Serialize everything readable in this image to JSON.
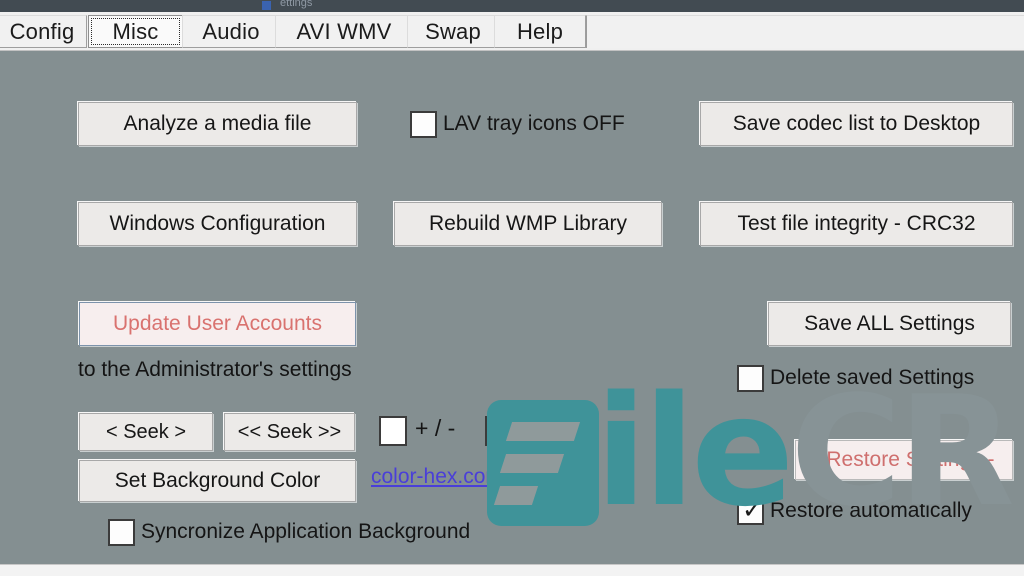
{
  "window": {
    "title_fragment": "ettings",
    "app_icon": "app-icon"
  },
  "tabs": [
    {
      "id": "config",
      "label": "Config",
      "selected": false
    },
    {
      "id": "misc",
      "label": "Misc",
      "selected": true
    },
    {
      "id": "audio",
      "label": "Audio",
      "selected": false
    },
    {
      "id": "aviwmv",
      "label": "AVI WMV",
      "selected": false
    },
    {
      "id": "swap",
      "label": "Swap",
      "selected": false
    },
    {
      "id": "help",
      "label": "Help",
      "selected": false
    }
  ],
  "main": {
    "analyze_button": "Analyze a media file",
    "lav_tray_checkbox": {
      "label": "LAV tray icons OFF",
      "checked": false
    },
    "save_codec_button": "Save codec list to Desktop",
    "windows_config_button": "Windows Configuration",
    "rebuild_wmp_button": "Rebuild WMP Library",
    "test_integrity_button": "Test file integrity - CRC32",
    "update_accounts_button": "Update User Accounts",
    "update_accounts_note": "to the Administrator's settings",
    "save_all_button": "Save ALL Settings",
    "delete_saved_checkbox": {
      "label": "Delete saved Settings",
      "checked": false
    },
    "seek_button": "<  Seek  >",
    "seek_fast_button": "<< Seek >>",
    "plus_minus_label": "+ / -",
    "seek_value_left": "",
    "seek_value_right": "",
    "set_background_button": "Set Background Color",
    "color_hex_link": "color-hex.com",
    "sync_background_checkbox": {
      "label": "Syncronize Application Background",
      "checked": false
    },
    "restore_settings_button": "-  Restore Settings  -",
    "restore_auto_checkbox": {
      "label": "Restore automatically",
      "checked": true,
      "tick": "✓"
    }
  },
  "watermark": {
    "logo_letter": "F",
    "text_primary": "ile",
    "text_secondary": "CR",
    "color": "#3f9399"
  },
  "colors": {
    "background": "#848f91",
    "button_face": "#eceae8",
    "accent_red": "#d9726f",
    "link_blue": "#4a3fd8",
    "teal": "#3f9399"
  }
}
